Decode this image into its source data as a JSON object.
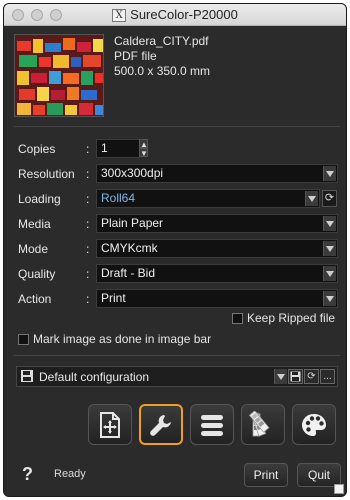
{
  "window": {
    "title": "SureColor-P20000",
    "title_icon": "x-icon"
  },
  "file": {
    "name": "Caldera_CITY.pdf",
    "type": "PDF file",
    "size": "500.0 x 350.0 mm"
  },
  "settings": {
    "copies": {
      "label": "Copies",
      "value": "1"
    },
    "resolution": {
      "label": "Resolution",
      "value": "300x300dpi"
    },
    "loading": {
      "label": "Loading",
      "value": "Roll64",
      "value_color": "#7fb6e8"
    },
    "media": {
      "label": "Media",
      "value": "Plain Paper"
    },
    "mode": {
      "label": "Mode",
      "value": "CMYKcmk"
    },
    "quality": {
      "label": "Quality",
      "value": "Draft - Bid"
    },
    "action": {
      "label": "Action",
      "value": "Print"
    },
    "colon": ":"
  },
  "options": {
    "keep_ripped": {
      "label": "Keep Ripped file",
      "checked": false
    },
    "mark_done": {
      "label": "Mark image as done in image bar",
      "checked": false
    }
  },
  "config": {
    "value": "Default configuration",
    "more_label": "..."
  },
  "toolbar": {
    "buttons": [
      {
        "name": "layout-icon",
        "active": false
      },
      {
        "name": "wrench-icon",
        "active": true
      },
      {
        "name": "list-icon",
        "active": false
      },
      {
        "name": "swatch-icon",
        "active": false
      },
      {
        "name": "palette-icon",
        "active": false
      }
    ],
    "active_color": "#f0a020"
  },
  "footer": {
    "help_label": "?",
    "status": "Ready",
    "print_label": "Print",
    "quit_label": "Quit"
  }
}
